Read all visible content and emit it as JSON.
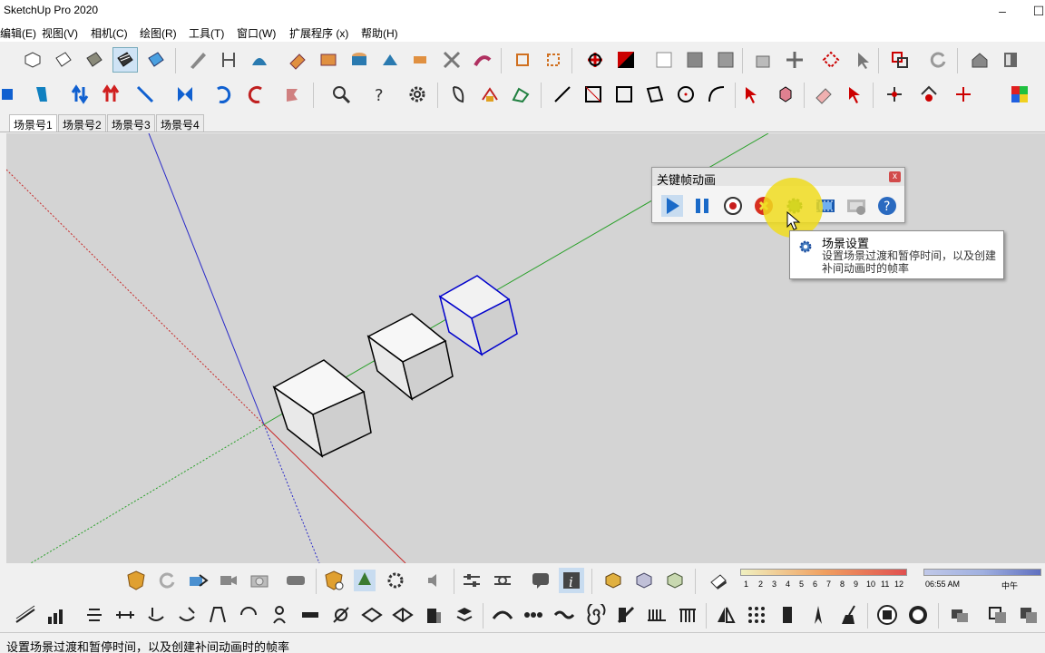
{
  "app": {
    "title": "SketchUp Pro 2020"
  },
  "window_controls": {
    "minimize": "–",
    "maximize": "☐"
  },
  "menubar": {
    "items": [
      "编辑(E)",
      "视图(V)",
      "相机(C)",
      "绘图(R)",
      "工具(T)",
      "窗口(W)",
      "扩展程序 (x)",
      "帮助(H)"
    ]
  },
  "scene_tabs": {
    "items": [
      "场景号1",
      "场景号2",
      "场景号3",
      "场景号4"
    ],
    "active_index": 0
  },
  "keyframe_panel": {
    "title": "关键帧动画",
    "close_label": "x",
    "buttons": [
      "play-icon",
      "pause-icon",
      "record-icon",
      "stop-icon",
      "scene-settings-icon",
      "film-icon",
      "film-delete-icon",
      "help-icon"
    ]
  },
  "tooltip": {
    "title": "场景设置",
    "description": "设置场景过渡和暂停时间，以及创建补间动画时的帧率"
  },
  "shadow_bar": {
    "month_ticks": [
      "1",
      "2",
      "3",
      "4",
      "5",
      "6",
      "7",
      "8",
      "9",
      "10",
      "11",
      "12"
    ],
    "time_start": "06:55 AM",
    "time_noon": "中午"
  },
  "status": {
    "text": "设置场景过渡和暂停时间，以及创建补间动画时的帧率"
  },
  "colors": {
    "axis_blue": "#2828c8",
    "axis_green": "#28a028",
    "axis_red": "#c82828",
    "selection_blue": "#0000cc",
    "highlight_yellow": "#f0dc1e",
    "viewport_bg": "#d4d4d4"
  }
}
